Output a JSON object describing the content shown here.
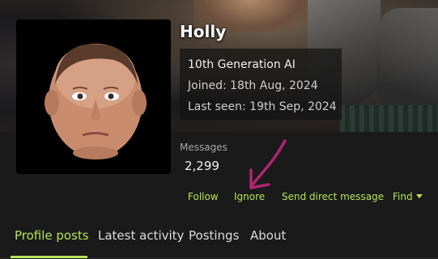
{
  "profile": {
    "username": "Holly",
    "title": "10th Generation AI",
    "joined": "Joined: 18th Aug, 2024",
    "last_seen": "Last seen: 19th Sep, 2024"
  },
  "stats": {
    "messages_label": "Messages",
    "messages_value": "2,299"
  },
  "actions": {
    "follow": "Follow",
    "ignore": "Ignore",
    "send_dm": "Send direct message",
    "find": "Find"
  },
  "tabs": [
    {
      "label": "Profile posts",
      "active": true
    },
    {
      "label": "Latest activity",
      "active": false
    },
    {
      "label": "Postings",
      "active": false
    },
    {
      "label": "About",
      "active": false
    }
  ],
  "colors": {
    "accent": "#b6e35b",
    "annotation_arrow": "#b0246f",
    "background": "#1a1a1a"
  },
  "icons": {
    "find_dropdown": "chevron-down-icon",
    "annotation": "arrow-annotation"
  }
}
